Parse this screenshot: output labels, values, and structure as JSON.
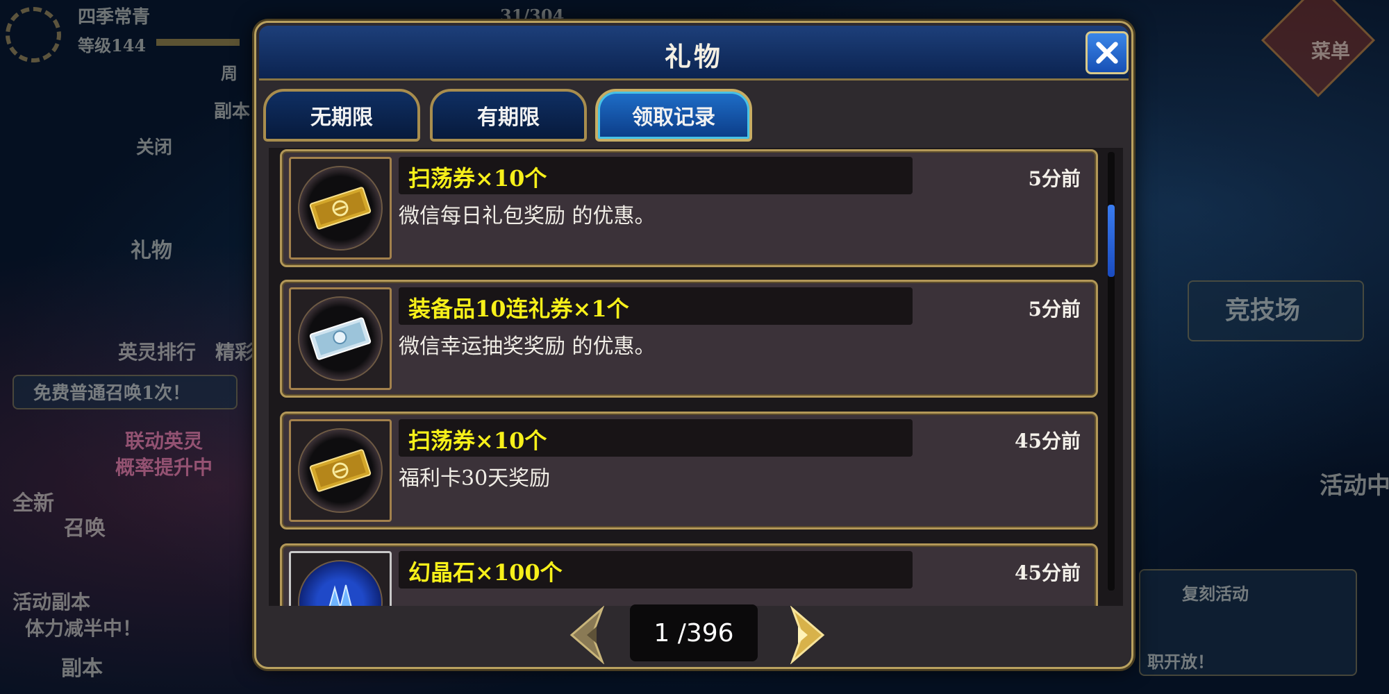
{
  "background": {
    "player_name": "四季常青",
    "level_label": "等级144",
    "menu_label": "菜单",
    "left_labels": [
      "周",
      "副本",
      "关闭",
      "礼物",
      "英灵排行",
      "精彩",
      "免费普通召唤1次！",
      "联动英灵",
      "概率提升中",
      "全新",
      "召唤",
      "活动副本",
      "体力减半中！",
      "副本"
    ],
    "right_labels": [
      "竞技场",
      "活动中",
      "复刻活动",
      "职开放！"
    ],
    "count_text": "31/304"
  },
  "dialog": {
    "title": "礼物",
    "close_icon": "close-x-icon"
  },
  "tabs": [
    {
      "label": "无期限",
      "active": false
    },
    {
      "label": "有期限",
      "active": false
    },
    {
      "label": "领取记录",
      "active": true
    }
  ],
  "items": [
    {
      "name": "扫荡券×10个",
      "time": "5分前",
      "desc": "微信每日礼包奖励 的优惠。",
      "icon": "gold-ticket-icon"
    },
    {
      "name": "装备品10连礼券×1个",
      "time": "5分前",
      "desc": "微信幸运抽奖奖励 的优惠。",
      "icon": "silver-ticket-icon"
    },
    {
      "name": "扫荡券×10个",
      "time": "45分前",
      "desc": "福利卡30天奖励",
      "icon": "gold-ticket-icon"
    },
    {
      "name": "幻晶石×100个",
      "time": "45分前",
      "desc": "",
      "icon": "crystal-icon"
    }
  ],
  "pagination": {
    "current": "1",
    "total": " /396"
  },
  "colors": {
    "item_name": "#f7f01a",
    "accent_gold": "#b9a15f",
    "tab_active": "#1f6fc9"
  }
}
